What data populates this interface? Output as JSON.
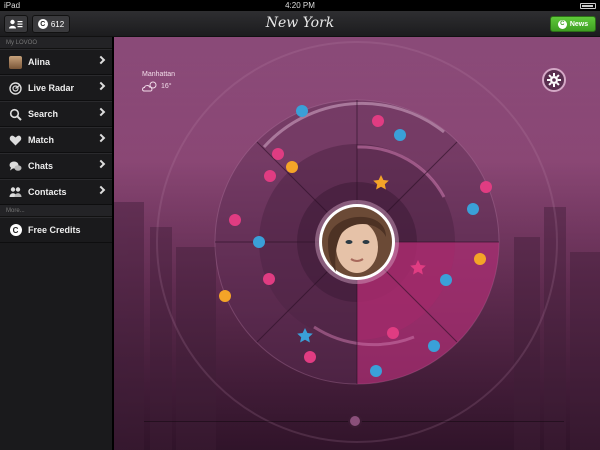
{
  "status_bar": {
    "carrier": "iPad",
    "time": "4:20 PM"
  },
  "top_nav": {
    "credits_count": "612",
    "city_title": "New York",
    "news_label": "News"
  },
  "sidebar": {
    "section_my": "My LOVOO",
    "items": [
      {
        "label": "Alina",
        "icon": "user-avatar"
      },
      {
        "label": "Live Radar",
        "icon": "radar-icon"
      },
      {
        "label": "Search",
        "icon": "search-icon"
      },
      {
        "label": "Match",
        "icon": "heart-icon"
      },
      {
        "label": "Chats",
        "icon": "chat-icon"
      },
      {
        "label": "Contacts",
        "icon": "contacts-icon"
      }
    ],
    "section_more": "More...",
    "more_items": [
      {
        "label": "Free Credits",
        "icon": "credits-icon"
      }
    ]
  },
  "weather": {
    "location": "Manhattan",
    "temperature": "16°"
  },
  "colors": {
    "pink_dot": "#e03c82",
    "blue_dot": "#3aa0d8",
    "orange_dot": "#f4a428",
    "news_green": "#4fb52e"
  }
}
